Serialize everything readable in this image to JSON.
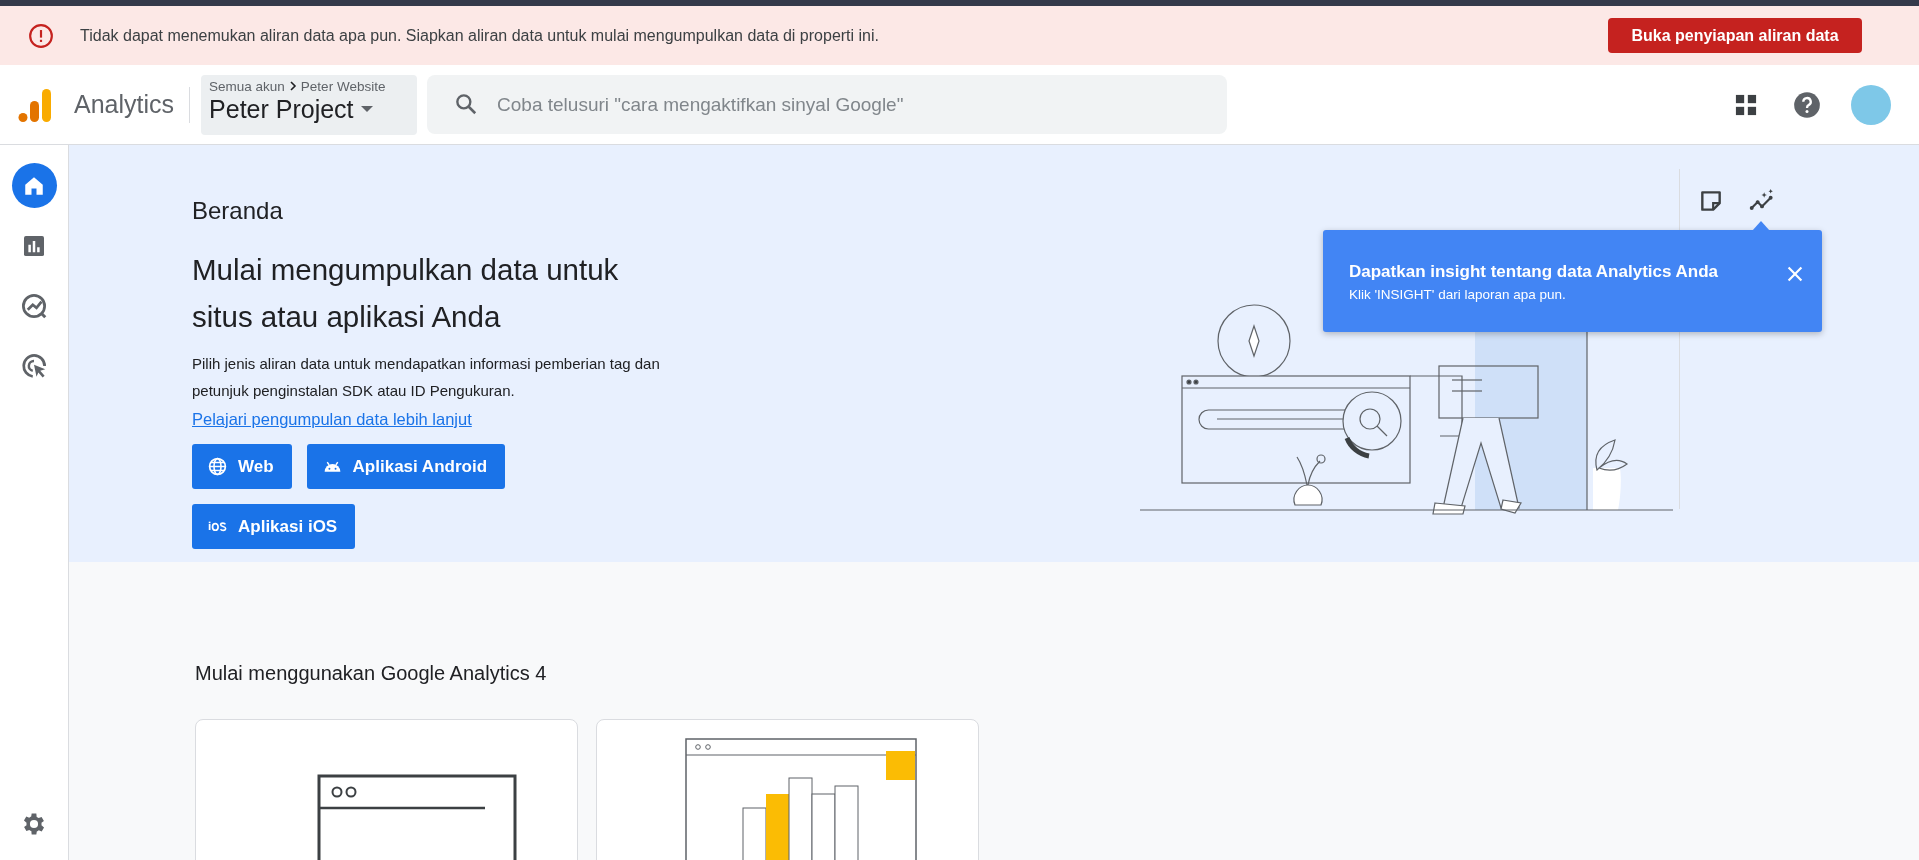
{
  "alert": {
    "message": "Tidak dapat menemukan aliran data apa pun. Siapkan aliran data untuk mulai mengumpulkan data di properti ini.",
    "action": "Buka penyiapan aliran data"
  },
  "header": {
    "product": "Analytics",
    "breadcrumb": [
      "Semua akun",
      "Peter Website"
    ],
    "property": "Peter Project",
    "search": {
      "placeholder": "Coba telusuri \"cara mengaktifkan sinyal Google\""
    }
  },
  "nav": {
    "items": [
      {
        "kind": "home",
        "selected": true
      },
      {
        "kind": "reports",
        "selected": false
      },
      {
        "kind": "explore",
        "selected": false
      },
      {
        "kind": "advertising",
        "selected": false
      }
    ]
  },
  "hero": {
    "title": "Beranda",
    "heading": "Mulai mengumpulkan data untuk situs atau aplikasi Anda",
    "description": "Pilih jenis aliran data untuk mendapatkan informasi pemberian tag dan petunjuk penginstalan SDK atau ID Pengukuran.",
    "link": "Pelajari pengumpulan data lebih lanjut",
    "platforms": [
      {
        "kind": "web",
        "label": "Web"
      },
      {
        "kind": "android",
        "label": "Aplikasi Android"
      },
      {
        "kind": "ios",
        "label": "Aplikasi iOS"
      }
    ]
  },
  "tooltip": {
    "title": "Dapatkan insight tentang data Analytics Anda",
    "text": "Klik 'INSIGHT' dari laporan apa pun."
  },
  "get_started": {
    "title": "Mulai menggunakan Google Analytics 4",
    "cards": [
      {
        "kind": "setup"
      },
      {
        "kind": "reports"
      }
    ]
  }
}
